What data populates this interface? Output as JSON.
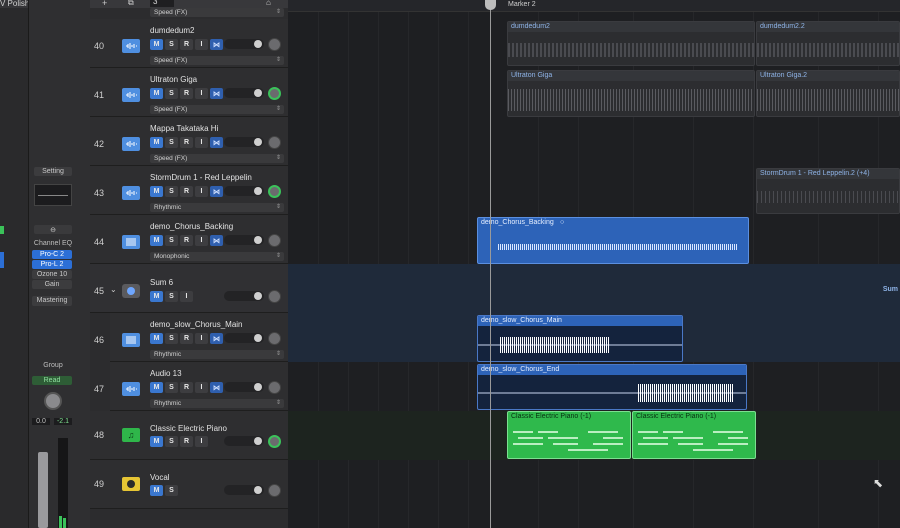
{
  "inspector": {
    "top_label": "V Polished Smooth",
    "setting": "Setting",
    "channel_eq": "Channel EQ",
    "plugins": [
      "Pro-C 2",
      "Pro-L 2",
      "Ozone 10",
      "Gain"
    ],
    "mastering": "Mastering",
    "group": "Group",
    "automation": "Read",
    "volume": "0.0",
    "peak": "-2.1"
  },
  "header": {
    "number_field": "3"
  },
  "tracks": [
    {
      "num": "40",
      "name": "dumdedum2",
      "mode": "Speed (FX)",
      "icon": "waveform-icon",
      "type": "audio"
    },
    {
      "num": "41",
      "name": "Ultraton Giga",
      "mode": "Speed (FX)",
      "icon": "waveform-icon",
      "type": "audio"
    },
    {
      "num": "42",
      "name": "Mappa Takataka Hi",
      "mode": "Speed (FX)",
      "icon": "waveform-icon",
      "type": "audio"
    },
    {
      "num": "43",
      "name": "StormDrum 1 - Red Leppelin",
      "mode": "Rhythmic",
      "icon": "waveform-icon",
      "type": "audio"
    },
    {
      "num": "44",
      "name": "demo_Chorus_Backing",
      "mode": "Monophonic",
      "icon": "piano-icon",
      "type": "audio"
    },
    {
      "num": "45",
      "name": "Sum 6",
      "mode": "",
      "icon": "summing-stack-icon",
      "type": "sum"
    },
    {
      "num": "46",
      "name": "demo_slow_Chorus_Main",
      "mode": "Rhythmic",
      "icon": "piano-icon",
      "type": "audio"
    },
    {
      "num": "47",
      "name": "Audio 13",
      "mode": "Rhythmic",
      "icon": "waveform-icon",
      "type": "audio"
    },
    {
      "num": "48",
      "name": "Classic Electric Piano",
      "mode": "",
      "icon": "music-note-icon",
      "type": "inst"
    },
    {
      "num": "49",
      "name": "Vocal",
      "mode": "",
      "icon": "tuner-icon",
      "type": "vocal"
    }
  ],
  "buttons": {
    "mute": "M",
    "solo": "S",
    "record": "R",
    "input": "I"
  },
  "arrange": {
    "marker": "Marker 2",
    "sum_label": "Sum",
    "regions": {
      "dum1": "dumdedum2",
      "dum2": "dumdedum2.2",
      "ult1": "Ultraton Giga",
      "ult2": "Ultraton Giga.2",
      "storm": "StormDrum 1 - Red Leppelin.2 (+4)",
      "backing": "demo_Chorus_Backing",
      "main": "demo_slow_Chorus_Main",
      "end": "demo_slow_Chorus_End",
      "piano1": "Classic Electric Piano (-1)",
      "piano2": "Classic Electric Piano (-1)"
    }
  }
}
